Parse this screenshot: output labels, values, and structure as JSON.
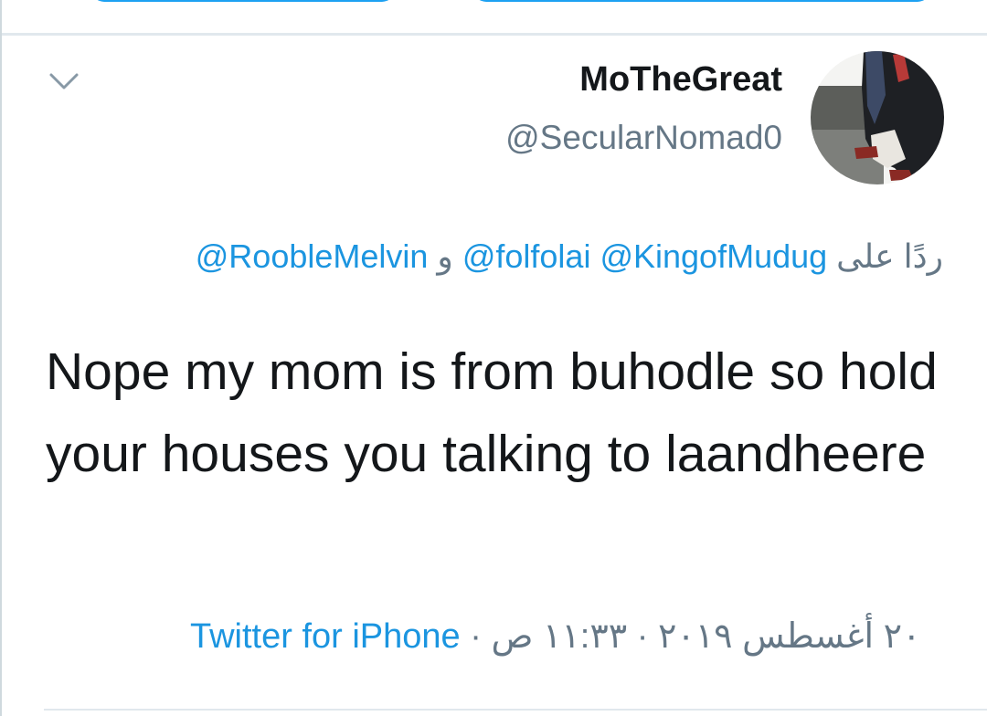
{
  "tweet": {
    "display_name": "MoTheGreat",
    "handle": "@SecularNomad0",
    "reply_prefix": "ردًا على",
    "reply_mention_1": "@KingofMudug",
    "reply_mention_2": "@folfolai",
    "reply_conjunction": "و",
    "reply_mention_3": "@RoobleMelvin",
    "text": "Nope my mom is from buhodle so hold your houses you talking to laandheere",
    "time": "١١:٣٣ ص",
    "date": "٢٠ أغسطس ٢٠١٩",
    "separator": "·",
    "source": "Twitter for iPhone"
  },
  "icons": {
    "menu": "chevron-down-icon",
    "avatar": "profile-photo"
  },
  "colors": {
    "accent": "#1b95e0",
    "text_primary": "#14171a",
    "text_secondary": "#657786",
    "divider": "#e1e8ed"
  }
}
